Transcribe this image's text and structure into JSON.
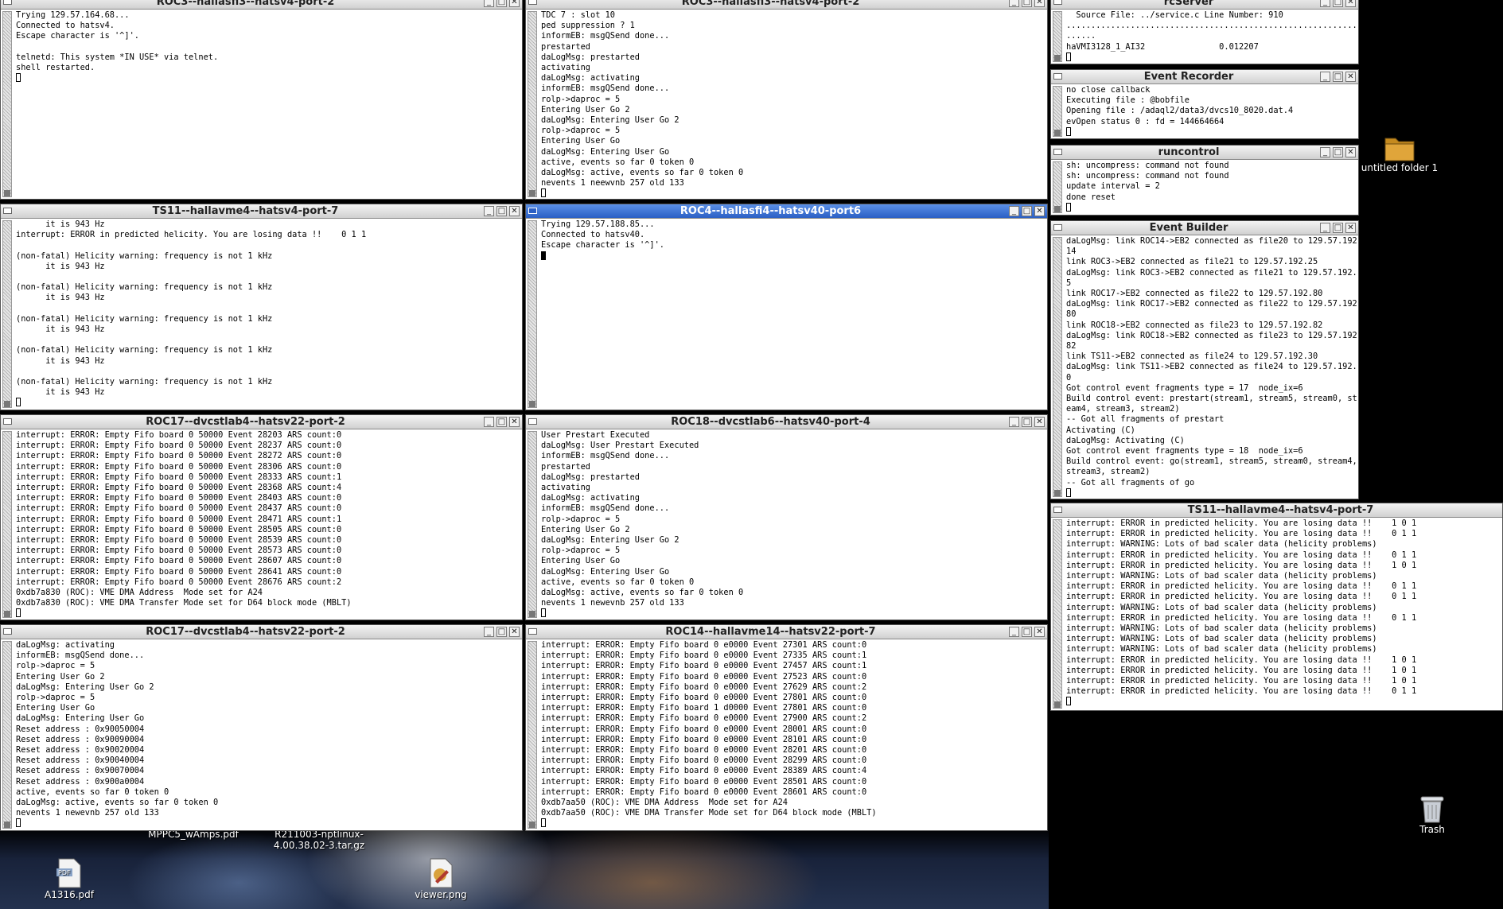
{
  "desktop": {
    "icons": [
      {
        "label": "untitled folder 1",
        "icon": "folder-icon"
      },
      {
        "label": "Trash",
        "icon": "trash-icon"
      },
      {
        "label": "A1316.pdf",
        "icon": "pdf-file-icon"
      },
      {
        "label": "viewer.png",
        "icon": "image-file-icon"
      },
      {
        "label": "MPPC5_wAmps.pdf",
        "icon": "pdf-file-icon"
      },
      {
        "label": "R211003-nptlinux-4.00.38.02-3.tar.gz",
        "icon": "archive-file-icon"
      }
    ]
  },
  "windows": [
    {
      "title": "ROC3--hallasfi3--hatsv4-port-2",
      "active": false,
      "lines": [
        "Trying 129.57.164.68...",
        "Connected to hatsv4.",
        "Escape character is '^]'.",
        "",
        "telnetd: This system *IN USE* via telnet.",
        "shell restarted."
      ]
    },
    {
      "title": "ROC3--hallasfi3--hatsv4-port-2",
      "active": false,
      "lines": [
        "TDC 7 : slot 10",
        "ped suppression ? 1",
        "informEB: msgQSend done...",
        "prestarted",
        "daLogMsg: prestarted",
        "activating",
        "daLogMsg: activating",
        "informEB: msgQSend done...",
        "rolp->daproc = 5",
        "Entering User Go 2",
        "daLogMsg: Entering User Go 2",
        "rolp->daproc = 5",
        "Entering User Go",
        "daLogMsg: Entering User Go",
        "active, events so far 0 token 0",
        "daLogMsg: active, events so far 0 token 0",
        "nevents 1 neewvnb 257 old 133"
      ]
    },
    {
      "title": "rcServer",
      "active": false,
      "lines": [
        "  Source File: ../service.c Line Number: 910",
        "..............................................................",
        "......",
        "haVMI3128_1_AI32               0.012207"
      ]
    },
    {
      "title": "Event Recorder",
      "active": false,
      "lines": [
        "no close callback",
        "Executing file : @bobfile",
        "Opening file : /adaql2/data3/dvcs10_8020.dat.4",
        "evOpen status 0 : fd = 144664664"
      ]
    },
    {
      "title": "runcontrol",
      "active": false,
      "lines": [
        "sh: uncompress: command not found",
        "sh: uncompress: command not found",
        "update interval = 2",
        "done reset"
      ]
    },
    {
      "title": "TS11--hallavme4--hatsv4-port-7",
      "active": false,
      "lines": [
        "      it is 943 Hz",
        "interrupt: ERROR in predicted helicity. You are losing data !!    0 1 1",
        "",
        "(non-fatal) Helicity warning: frequency is not 1 kHz",
        "      it is 943 Hz",
        "",
        "(non-fatal) Helicity warning: frequency is not 1 kHz",
        "      it is 943 Hz",
        "",
        "(non-fatal) Helicity warning: frequency is not 1 kHz",
        "      it is 943 Hz",
        "",
        "(non-fatal) Helicity warning: frequency is not 1 kHz",
        "      it is 943 Hz",
        "",
        "(non-fatal) Helicity warning: frequency is not 1 kHz",
        "      it is 943 Hz"
      ]
    },
    {
      "title": "ROC4--hallasfi4--hatsv40-port6",
      "active": true,
      "lines": [
        "Trying 129.57.188.85...",
        "Connected to hatsv40.",
        "Escape character is '^]'."
      ]
    },
    {
      "title": "Event Builder",
      "active": false,
      "lines": [
        "daLogMsg: link ROC14->EB2 connected as file20 to 129.57.192.",
        "14",
        "link ROC3->EB2 connected as file21 to 129.57.192.25",
        "daLogMsg: link ROC3->EB2 connected as file21 to 129.57.192.2",
        "5",
        "link ROC17->EB2 connected as file22 to 129.57.192.80",
        "daLogMsg: link ROC17->EB2 connected as file22 to 129.57.192.",
        "80",
        "link ROC18->EB2 connected as file23 to 129.57.192.82",
        "daLogMsg: link ROC18->EB2 connected as file23 to 129.57.192.",
        "82",
        "link TS11->EB2 connected as file24 to 129.57.192.30",
        "daLogMsg: link TS11->EB2 connected as file24 to 129.57.192.3",
        "0",
        "Got control event fragments type = 17  node_ix=6",
        "Build control event: prestart(stream1, stream5, stream0, str",
        "eam4, stream3, stream2)",
        "-- Got all fragments of prestart",
        "Activating (C)",
        "daLogMsg: Activating (C)",
        "Got control event fragments type = 18  node_ix=6",
        "Build control event: go(stream1, stream5, stream0, stream4,",
        "stream3, stream2)",
        "-- Got all fragments of go"
      ]
    },
    {
      "title": "ROC17--dvcstlab4--hatsv22-port-2",
      "active": false,
      "lines": [
        "interrupt: ERROR: Empty Fifo board 0 50000 Event 28203 ARS count:0",
        "interrupt: ERROR: Empty Fifo board 0 50000 Event 28237 ARS count:0",
        "interrupt: ERROR: Empty Fifo board 0 50000 Event 28272 ARS count:0",
        "interrupt: ERROR: Empty Fifo board 0 50000 Event 28306 ARS count:0",
        "interrupt: ERROR: Empty Fifo board 0 50000 Event 28333 ARS count:1",
        "interrupt: ERROR: Empty Fifo board 0 50000 Event 28368 ARS count:4",
        "interrupt: ERROR: Empty Fifo board 0 50000 Event 28403 ARS count:0",
        "interrupt: ERROR: Empty Fifo board 0 50000 Event 28437 ARS count:0",
        "interrupt: ERROR: Empty Fifo board 0 50000 Event 28471 ARS count:1",
        "interrupt: ERROR: Empty Fifo board 0 50000 Event 28505 ARS count:0",
        "interrupt: ERROR: Empty Fifo board 0 50000 Event 28539 ARS count:0",
        "interrupt: ERROR: Empty Fifo board 0 50000 Event 28573 ARS count:0",
        "interrupt: ERROR: Empty Fifo board 0 50000 Event 28607 ARS count:0",
        "interrupt: ERROR: Empty Fifo board 0 50000 Event 28641 ARS count:0",
        "interrupt: ERROR: Empty Fifo board 0 50000 Event 28676 ARS count:2",
        "0xdb7a830 (ROC): VME DMA Address  Mode set for A24",
        "0xdb7a830 (ROC): VME DMA Transfer Mode set for D64 block mode (MBLT)"
      ]
    },
    {
      "title": "ROC18--dvcstlab6--hatsv40-port-4",
      "active": false,
      "lines": [
        "User Prestart Executed",
        "daLogMsg: User Prestart Executed",
        "informEB: msgQSend done...",
        "prestarted",
        "daLogMsg: prestarted",
        "activating",
        "daLogMsg: activating",
        "informEB: msgQSend done...",
        "rolp->daproc = 5",
        "Entering User Go 2",
        "daLogMsg: Entering User Go 2",
        "rolp->daproc = 5",
        "Entering User Go",
        "daLogMsg: Entering User Go",
        "active, events so far 0 token 0",
        "daLogMsg: active, events so far 0 token 0",
        "nevents 1 newevnb 257 old 133"
      ]
    },
    {
      "title": "TS11--hallavme4--hatsv4-port-7",
      "active": false,
      "lines": [
        "interrupt: ERROR in predicted helicity. You are losing data !!    1 0 1",
        "interrupt: ERROR in predicted helicity. You are losing data !!    0 1 1",
        "interrupt: WARNING: Lots of bad scaler data (helicity problems)",
        "interrupt: ERROR in predicted helicity. You are losing data !!    0 1 1",
        "interrupt: ERROR in predicted helicity. You are losing data !!    1 0 1",
        "interrupt: WARNING: Lots of bad scaler data (helicity problems)",
        "interrupt: ERROR in predicted helicity. You are losing data !!    0 1 1",
        "interrupt: ERROR in predicted helicity. You are losing data !!    0 1 1",
        "interrupt: WARNING: Lots of bad scaler data (helicity problems)",
        "interrupt: ERROR in predicted helicity. You are losing data !!    0 1 1",
        "interrupt: WARNING: Lots of bad scaler data (helicity problems)",
        "interrupt: WARNING: Lots of bad scaler data (helicity problems)",
        "interrupt: WARNING: Lots of bad scaler data (helicity problems)",
        "interrupt: ERROR in predicted helicity. You are losing data !!    1 0 1",
        "interrupt: ERROR in predicted helicity. You are losing data !!    1 0 1",
        "interrupt: ERROR in predicted helicity. You are losing data !!    1 0 1",
        "interrupt: ERROR in predicted helicity. You are losing data !!    0 1 1"
      ]
    },
    {
      "title": "ROC17--dvcstlab4--hatsv22-port-2",
      "active": false,
      "lines": [
        "daLogMsg: activating",
        "informEB: msgQSend done...",
        "rolp->daproc = 5",
        "Entering User Go 2",
        "daLogMsg: Entering User Go 2",
        "rolp->daproc = 5",
        "Entering User Go",
        "daLogMsg: Entering User Go",
        "Reset address : 0x90050004",
        "Reset address : 0x90090004",
        "Reset address : 0x90020004",
        "Reset address : 0x90040004",
        "Reset address : 0x90070004",
        "Reset address : 0x900a0004",
        "active, events so far 0 token 0",
        "daLogMsg: active, events so far 0 token 0",
        "nevents 1 newevnb 257 old 133"
      ]
    },
    {
      "title": "ROC14--hallavme14--hatsv22-port-7",
      "active": false,
      "lines": [
        "interrupt: ERROR: Empty Fifo board 0 e0000 Event 27301 ARS count:0",
        "interrupt: ERROR: Empty Fifo board 0 e0000 Event 27335 ARS count:1",
        "interrupt: ERROR: Empty Fifo board 0 e0000 Event 27457 ARS count:1",
        "interrupt: ERROR: Empty Fifo board 0 e0000 Event 27523 ARS count:0",
        "interrupt: ERROR: Empty Fifo board 0 e0000 Event 27629 ARS count:2",
        "interrupt: ERROR: Empty Fifo board 0 e0000 Event 27801 ARS count:0",
        "interrupt: ERROR: Empty Fifo board 1 d0000 Event 27801 ARS count:0",
        "interrupt: ERROR: Empty Fifo board 0 e0000 Event 27900 ARS count:2",
        "interrupt: ERROR: Empty Fifo board 0 e0000 Event 28001 ARS count:0",
        "interrupt: ERROR: Empty Fifo board 0 e0000 Event 28101 ARS count:0",
        "interrupt: ERROR: Empty Fifo board 0 e0000 Event 28201 ARS count:0",
        "interrupt: ERROR: Empty Fifo board 0 e0000 Event 28299 ARS count:0",
        "interrupt: ERROR: Empty Fifo board 0 e0000 Event 28389 ARS count:4",
        "interrupt: ERROR: Empty Fifo board 0 e0000 Event 28501 ARS count:0",
        "interrupt: ERROR: Empty Fifo board 0 e0000 Event 28601 ARS count:0",
        "0xdb7aa50 (ROC): VME DMA Address  Mode set for A24",
        "0xdb7aa50 (ROC): VME DMA Transfer Mode set for D64 block mode (MBLT)"
      ]
    }
  ]
}
